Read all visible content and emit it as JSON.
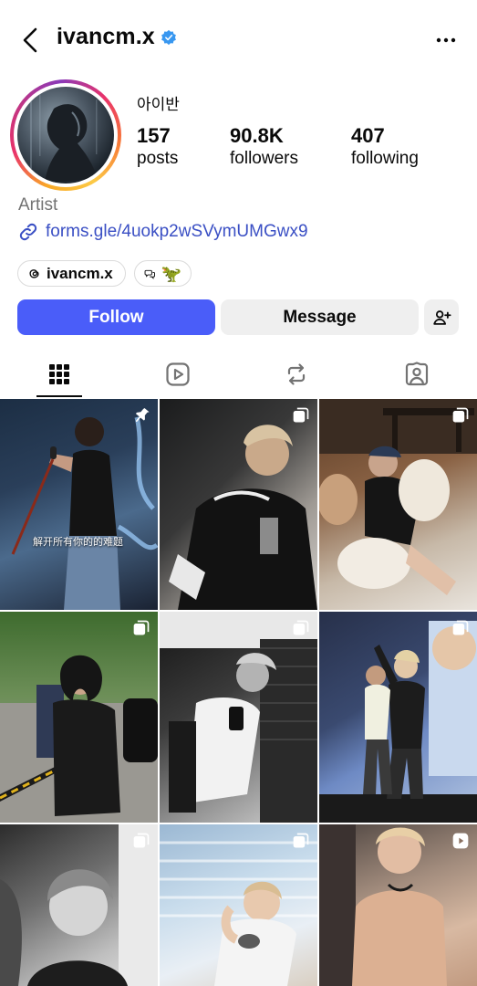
{
  "header": {
    "username": "ivancm.x",
    "verified": true,
    "back_icon": "chevron-left-icon",
    "more_icon": "ellipsis-icon"
  },
  "profile": {
    "full_name": "아이반",
    "stats": [
      {
        "value": "157",
        "label": "posts"
      },
      {
        "value": "90.8K",
        "label": "followers"
      },
      {
        "value": "407",
        "label": "following"
      }
    ],
    "category": "Artist",
    "link": "forms.gle/4uokp2wSVymUMGwx9",
    "threads_chip": "ivancm.x",
    "emoji_chip": "🦖"
  },
  "actions": {
    "follow": "Follow",
    "message": "Message",
    "add_user_icon": "person-add-icon"
  },
  "tabs": [
    {
      "name": "posts",
      "icon": "grid-icon",
      "active": true
    },
    {
      "name": "reels",
      "icon": "reels-icon",
      "active": false
    },
    {
      "name": "reposts",
      "icon": "repost-icon",
      "active": false
    },
    {
      "name": "tagged",
      "icon": "tagged-icon",
      "active": false
    }
  ],
  "posts": [
    {
      "badge": "pin-icon",
      "caption": "解开所有你的的难题"
    },
    {
      "badge": "carousel-icon"
    },
    {
      "badge": "carousel-icon"
    },
    {
      "badge": "carousel-icon"
    },
    {
      "badge": "carousel-icon"
    },
    {
      "badge": "carousel-icon"
    },
    {
      "badge": "carousel-icon"
    },
    {
      "badge": "carousel-icon"
    },
    {
      "badge": "reel-icon"
    }
  ],
  "colors": {
    "follow_button": "#4a5df9",
    "link": "#3a4fc4",
    "secondary_button": "#efefef",
    "verified": "#3897f0"
  }
}
